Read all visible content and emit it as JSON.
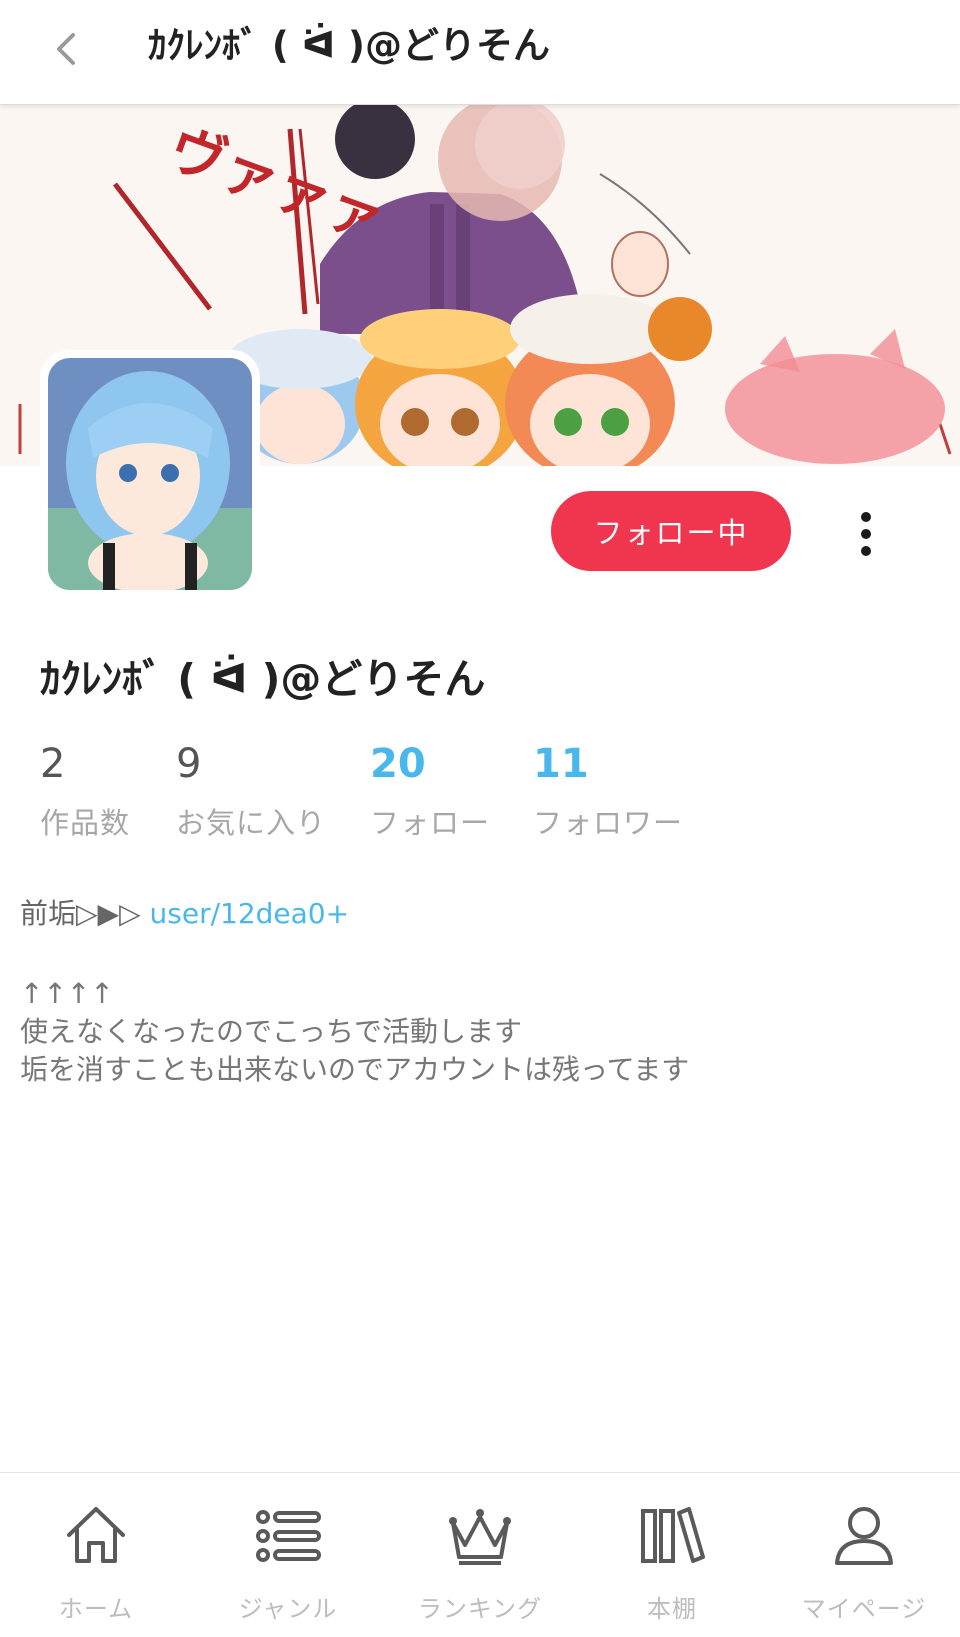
{
  "header": {
    "title": "ｶｸﾚﾝﾎﾞ ( ᐛ )@どりそん",
    "back_icon": "chevron-left-icon"
  },
  "profile": {
    "name": "ｶｸﾚﾝﾎﾞ ( ᐛ )@どりそん",
    "follow_button_label": "フォロー中",
    "more_icon": "vertical-dots-icon",
    "stats": [
      {
        "value": "2",
        "label": "作品数"
      },
      {
        "value": "9",
        "label": "お気に入り"
      },
      {
        "value": "20",
        "label": "フォロー"
      },
      {
        "value": "11",
        "label": "フォロワー"
      }
    ],
    "bio_prefix": "前垢▷▶▷ ",
    "bio_link": "user/12dea0+",
    "bio_body": "↑↑↑↑\n使えなくなったのでこっちで活動します\n垢を消すことも出来ないのでアカウントは残ってます"
  },
  "banner": {
    "sfx_text": "ヴァァァ"
  },
  "bottom_nav": [
    {
      "label": "ホーム",
      "icon": "home-icon"
    },
    {
      "label": "ジャンル",
      "icon": "list-icon"
    },
    {
      "label": "ランキング",
      "icon": "crown-icon"
    },
    {
      "label": "本棚",
      "icon": "bookshelf-icon"
    },
    {
      "label": "マイページ",
      "icon": "user-icon"
    }
  ],
  "colors": {
    "accent": "#f0364f",
    "link": "#4ab7ec",
    "nav_icon": "#5a5a5a"
  }
}
